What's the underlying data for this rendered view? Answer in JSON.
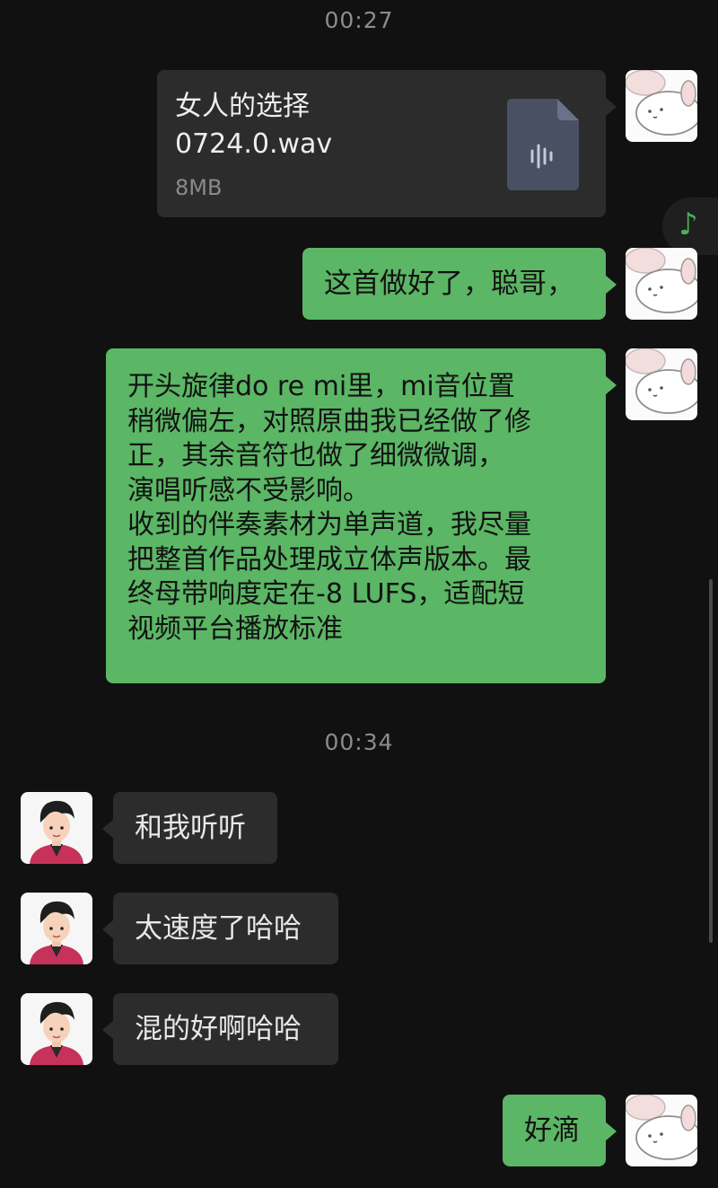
{
  "timestamps": [
    "00:27",
    "00:34"
  ],
  "file_message": {
    "name": "女人的选择\n 0724.0.wav",
    "size": "8MB",
    "icon": "audio-file-icon"
  },
  "messages": [
    {
      "side": "right",
      "text": "这首做好了，聪哥，"
    },
    {
      "side": "right",
      "text": "开头旋律do re mi里，mi音位置\n稍微偏左，对照原曲我已经做了修\n正，其余音符也做了细微微调，\n演唱听感不受影响。\n收到的伴奏素材为单声道，我尽量\n把整首作品处理成立体声版本。最\n终母带响度定在-8 LUFS，适配短\n视频平台播放标准"
    },
    {
      "side": "left",
      "text": "和我听听"
    },
    {
      "side": "left",
      "text": "太速度了哈哈"
    },
    {
      "side": "left",
      "text": "混的好啊哈哈"
    },
    {
      "side": "right",
      "text": "好滴"
    }
  ],
  "floating_tab": {
    "icon": "music-note-icon",
    "glyph": "♪"
  },
  "colors": {
    "background": "#111111",
    "bubble_self": "#5bb665",
    "bubble_other": "#2c2c2c",
    "timestamp": "#8c8c8c",
    "accent": "#4cae5a"
  }
}
